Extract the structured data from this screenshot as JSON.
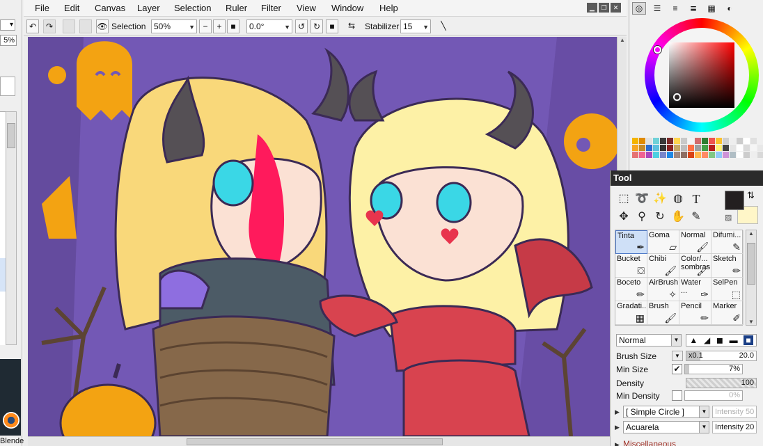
{
  "left_panel": {
    "dropdown_text": "",
    "zoom_percent": "5%",
    "thumbnail_caption": "Blende"
  },
  "menu": {
    "items": [
      "File",
      "Edit",
      "Canvas",
      "Layer",
      "Selection",
      "Ruler",
      "Filter",
      "View",
      "Window",
      "Help"
    ]
  },
  "toolbar": {
    "selection_label": "Selection",
    "zoom": "50%",
    "rotation": "0.0°",
    "stabilizer_label": "Stabilizer",
    "stabilizer_value": "15"
  },
  "color_panel": {
    "tabs": [
      "color-wheel-icon",
      "sliders-icon",
      "rgb-icon",
      "hsv-icon",
      "swatch-grid-icon",
      "scratchpad-icon"
    ],
    "active_tab": 0,
    "swatches": [
      "#f4b400",
      "#e08a00",
      "#e1e1e1",
      "#6fd1d8",
      "#3a3a3a",
      "#7c2a2a",
      "#ffd54f",
      "#c9c9c9",
      "#f4f4f4",
      "#d36b6b",
      "#2e7d32",
      "#ef5350",
      "#fbc02d",
      "#cfcfcf",
      "#eeeeee",
      "#cccccc",
      "#ffffff",
      "#e0e0e0",
      "#f0f0f0",
      "#f6a623",
      "#c48a2a",
      "#2a6bd1",
      "#5bc0de",
      "#333333",
      "#8a2222",
      "#c8a864",
      "#bdbdbd",
      "#ff7043",
      "#9e9e9e",
      "#43a047",
      "#b71c1c",
      "#fff176",
      "#424242",
      "#e4e4e4",
      "#ffffff",
      "#dadada",
      "#f5f5f5",
      "#e8e8e8",
      "#e57373",
      "#f06292",
      "#ab47bc",
      "#4dd0e1",
      "#7986cb",
      "#1e88e5",
      "#a1887f",
      "#8d6e63",
      "#d84315",
      "#ffb74d",
      "#ff8a65",
      "#81c784",
      "#90caf9",
      "#ce93d8",
      "#b0bec5",
      "#ffffff",
      "#cccccc",
      "#eeeeee",
      "#d9d9d9"
    ],
    "primary_color": "#231f20",
    "secondary_color": "#fff6c8"
  },
  "tool_panel": {
    "title": "Tool",
    "tool_icons": [
      "rect-select-icon",
      "lasso-icon",
      "magic-wand-icon",
      "select-pen-icon",
      "text-icon",
      "move-icon",
      "zoom-icon",
      "rotate-icon",
      "hand-icon",
      "eyedropper-icon"
    ],
    "text_tool_glyph": "T",
    "brushes": [
      {
        "name": "Tinta",
        "icon": "pen-icon",
        "selected": true
      },
      {
        "name": "Goma",
        "icon": "eraser-icon"
      },
      {
        "name": "Normal",
        "icon": "brush-icon"
      },
      {
        "name": "Difumi...",
        "icon": "blur-icon"
      },
      {
        "name": "Bucket",
        "icon": "bucket-icon"
      },
      {
        "name": "Chibi",
        "icon": "brush-icon"
      },
      {
        "name": "Color/... sombras",
        "icon": "brush-icon"
      },
      {
        "name": "Sketch",
        "icon": "pencil-icon"
      },
      {
        "name": "Boceto",
        "icon": "pencil-icon"
      },
      {
        "name": "AirBrush",
        "icon": "airbrush-icon"
      },
      {
        "name": "Water ...",
        "icon": "water-brush-icon"
      },
      {
        "name": "SelPen",
        "icon": "selpen-icon"
      },
      {
        "name": "Gradati...",
        "icon": "gradient-icon"
      },
      {
        "name": "Brush",
        "icon": "brush-icon"
      },
      {
        "name": "Pencil",
        "icon": "pencil-icon"
      },
      {
        "name": "Marker",
        "icon": "marker-icon"
      }
    ],
    "blend_mode": "Normal",
    "brush_size": {
      "label": "Brush Size",
      "multiplier": "x0.1",
      "value": "20.0",
      "level": 0.2
    },
    "min_size": {
      "label": "Min Size",
      "checked": true,
      "value": "7%",
      "level": 0.07
    },
    "density": {
      "label": "Density",
      "value": "100",
      "level": 1.0
    },
    "min_density": {
      "label": "Min Density",
      "checked": false,
      "value": "0%",
      "level": 0.0
    },
    "shape_dropdown": "[ Simple Circle ]",
    "shape_intensity": "Intensity 50",
    "texture_dropdown": "Acuarela",
    "texture_intensity": "Intensity 20",
    "misc_label": "Miscellaneous"
  }
}
